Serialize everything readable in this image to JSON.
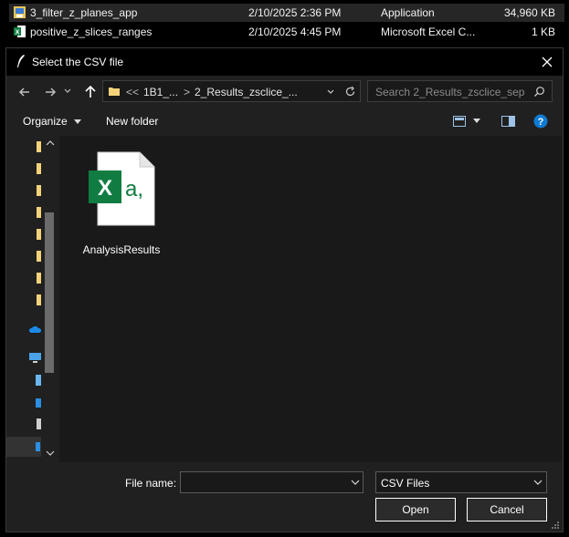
{
  "background_list": {
    "rows": [
      {
        "name": "3_filter_z_planes_app",
        "date": "2/10/2025 2:36 PM",
        "type": "Application",
        "size": "34,960 KB",
        "icon": "app-icon"
      },
      {
        "name": "positive_z_slices_ranges",
        "date": "2/10/2025 4:45 PM",
        "type": "Microsoft Excel C...",
        "size": "1 KB",
        "icon": "excel-csv-icon"
      }
    ]
  },
  "dialog": {
    "title": "Select the CSV file",
    "address": {
      "prefix": "<<",
      "crumb1": "1B1_...",
      "separator": ">",
      "crumb2": "2_Results_zsclice_..."
    },
    "search_placeholder": "Search 2_Results_zsclice_sep",
    "toolbar": {
      "organize_label": "Organize",
      "new_folder_label": "New folder"
    },
    "files": [
      {
        "name": "AnalysisResults",
        "icon": "excel-csv-icon"
      }
    ],
    "filename_label": "File name:",
    "filename_value": "",
    "filetype_value": "CSV Files",
    "open_label": "Open",
    "cancel_label": "Cancel"
  },
  "colors": {
    "accent": "#0f7ad1",
    "excel_green": "#107c41",
    "folder_yellow": "#f3d27a"
  }
}
